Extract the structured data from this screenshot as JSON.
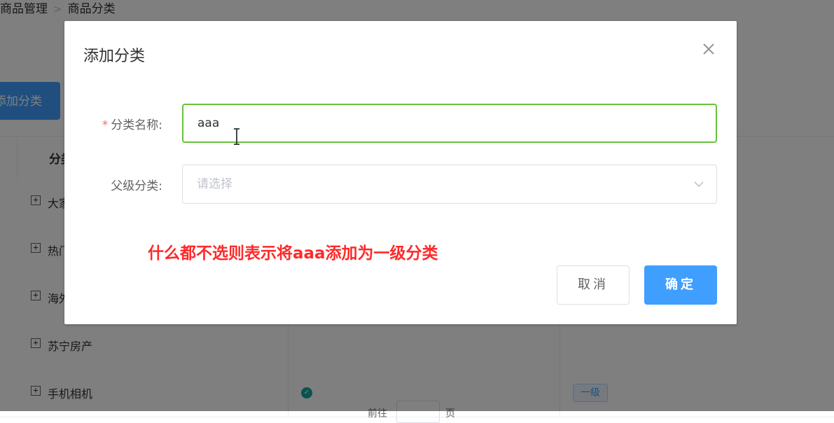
{
  "breadcrumb": {
    "item1": "商品管理",
    "item2": "商品分类",
    "separator": ">"
  },
  "toolbar": {
    "add_label": "添加分类"
  },
  "table": {
    "header_first": "分类名称",
    "rows": [
      {
        "name": "大家电"
      },
      {
        "name": "热门推荐"
      },
      {
        "name": "海外购"
      },
      {
        "name": "苏宁房产"
      },
      {
        "name": "手机相机",
        "valid": true,
        "level": "一级"
      }
    ],
    "expand_symbol": "+"
  },
  "pagination": {
    "goto_label": "前往",
    "page_label": "页"
  },
  "dialog": {
    "title": "添加分类",
    "name_label": "分类名称:",
    "required_mark": "*",
    "name_value": "aaa",
    "parent_label": "父级分类:",
    "parent_placeholder": "请选择",
    "note": "什么都不选则表示将aaa添加为一级分类",
    "cancel_label": "取消",
    "ok_label": "确定"
  },
  "colors": {
    "primary": "#409eff",
    "valid_green": "#67c23a",
    "required_red": "#f56c6c",
    "annotation_red": "#ff2a2a"
  },
  "icons": [
    "close-icon",
    "chevron-down-icon",
    "text-cursor-icon",
    "expand-icon",
    "check-circle-icon"
  ]
}
